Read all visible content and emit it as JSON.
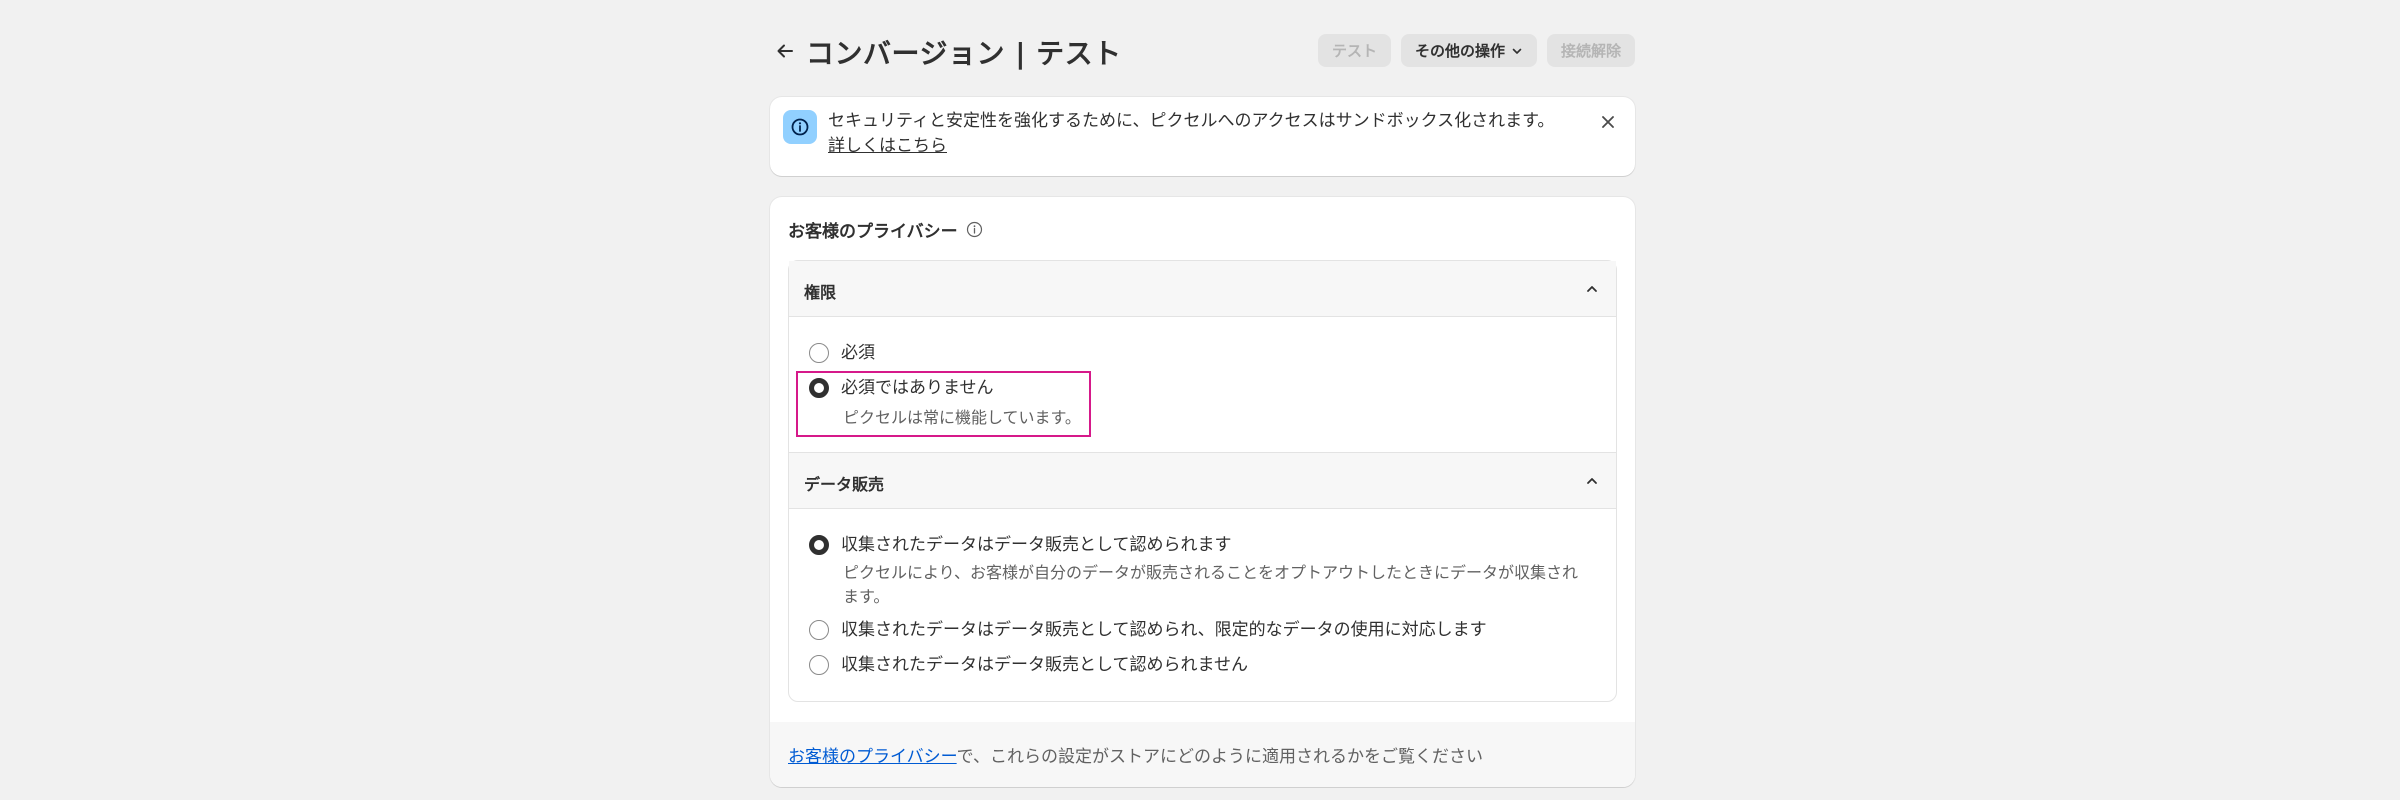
{
  "header": {
    "title": "コンバージョン | テスト",
    "back_icon": "arrow-left-icon",
    "actions": {
      "test_label": "テスト",
      "more_actions_label": "その他の操作",
      "disconnect_label": "接続解除"
    }
  },
  "banner": {
    "text": "セキュリティと安定性を強化するために、ピクセルへのアクセスはサンドボックス化されます。",
    "link_label": "詳しくはこちら"
  },
  "privacy_card": {
    "title": "お客様のプライバシー",
    "permission": {
      "title": "権限",
      "options": [
        {
          "label": "必須",
          "checked": false
        },
        {
          "label": "必須ではありません",
          "checked": true,
          "help": "ピクセルは常に機能しています。"
        }
      ]
    },
    "data_sale": {
      "title": "データ販売",
      "options": [
        {
          "label": "収集されたデータはデータ販売として認められます",
          "checked": true,
          "help": "ピクセルにより、お客様が自分のデータが販売されることをオプトアウトしたときにデータが収集されます。"
        },
        {
          "label": "収集されたデータはデータ販売として認められ、限定的なデータの使用に対応します",
          "checked": false
        },
        {
          "label": "収集されたデータはデータ販売として認められません",
          "checked": false
        }
      ]
    },
    "footer": {
      "link_label": "お客様のプライバシー",
      "text": "で、これらの設定がストアにどのように適用されるかをご覧ください"
    }
  },
  "colors": {
    "highlight": "#d6198a",
    "info_badge": "#91d0ff",
    "link": "#005bd3"
  }
}
